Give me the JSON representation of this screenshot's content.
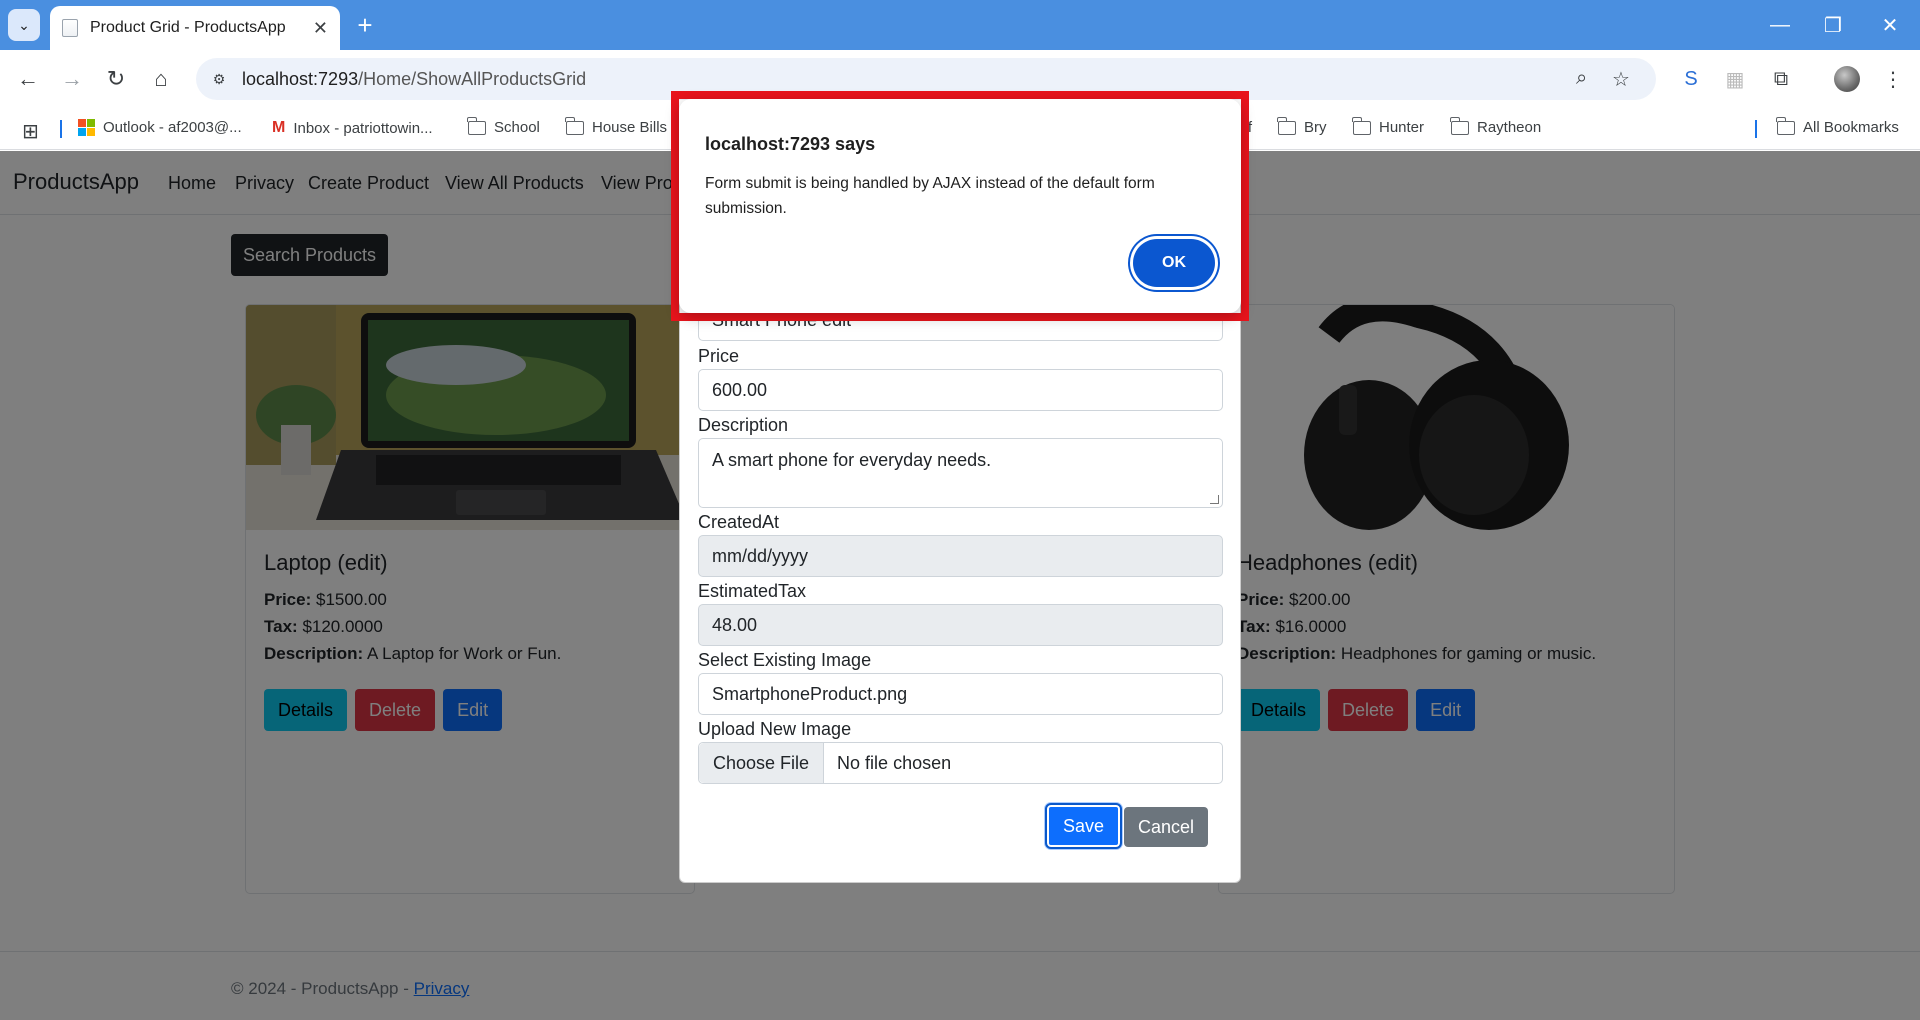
{
  "browser": {
    "tab_title": "Product Grid - ProductsApp",
    "url_host": "localhost:7293",
    "url_path": "/Home/ShowAllProductsGrid",
    "bookmarks": [
      {
        "label": "Outlook - af2003@...",
        "icon": "microsoft-icon"
      },
      {
        "label": "Inbox - patriottowin...",
        "icon": "gmail-icon"
      },
      {
        "label": "School",
        "icon": "folder-icon"
      },
      {
        "label": "House Bills",
        "icon": "folder-icon"
      },
      {
        "label": "ff",
        "icon": "folder-icon"
      },
      {
        "label": "Bry",
        "icon": "folder-icon"
      },
      {
        "label": "Hunter",
        "icon": "folder-icon"
      },
      {
        "label": "Raytheon",
        "icon": "folder-icon"
      },
      {
        "label": "All Bookmarks",
        "icon": "folder-icon"
      }
    ]
  },
  "app": {
    "brand": "ProductsApp",
    "nav": [
      "Home",
      "Privacy",
      "Create Product",
      "View All Products",
      "View Pro"
    ],
    "search_button": "Search Products"
  },
  "cards": [
    {
      "title": "Laptop (edit)",
      "price_label": "Price:",
      "price": "$1500.00",
      "tax_label": "Tax:",
      "tax": "$120.0000",
      "desc_label": "Description:",
      "desc": "A Laptop for Work or Fun.",
      "details": "Details",
      "delete": "Delete",
      "edit": "Edit"
    },
    {
      "title": "Headphones (edit)",
      "price_label": "Price:",
      "price": "$200.00",
      "tax_label": "Tax:",
      "tax": "$16.0000",
      "desc_label": "Description:",
      "desc": "Headphones for gaming or music.",
      "details": "Details",
      "delete": "Delete",
      "edit": "Edit"
    }
  ],
  "edit_form": {
    "name_value": "Smart Phone edit",
    "price_label": "Price",
    "price_value": "600.00",
    "description_label": "Description",
    "description_value": "A smart phone for everyday needs.",
    "created_label": "CreatedAt",
    "created_placeholder": "mm/dd/yyyy",
    "tax_label": "EstimatedTax",
    "tax_value": "48.00",
    "existing_image_label": "Select Existing Image",
    "existing_image_value": "SmartphoneProduct.png",
    "upload_label": "Upload New Image",
    "choose_file": "Choose File",
    "no_file": "No file chosen",
    "save": "Save",
    "cancel": "Cancel"
  },
  "alert": {
    "title": "localhost:7293 says",
    "message": "Form submit is being handled by AJAX instead of the default form submission.",
    "ok": "OK"
  },
  "footer": {
    "text": "© 2024 - ProductsApp - ",
    "privacy": "Privacy"
  },
  "colors": {
    "chrome_tabstrip": "#4a8fe0",
    "primary": "#0d6efd",
    "danger": "#dc3545",
    "info": "#0dcaf0",
    "alert_highlight": "#e8141c"
  }
}
